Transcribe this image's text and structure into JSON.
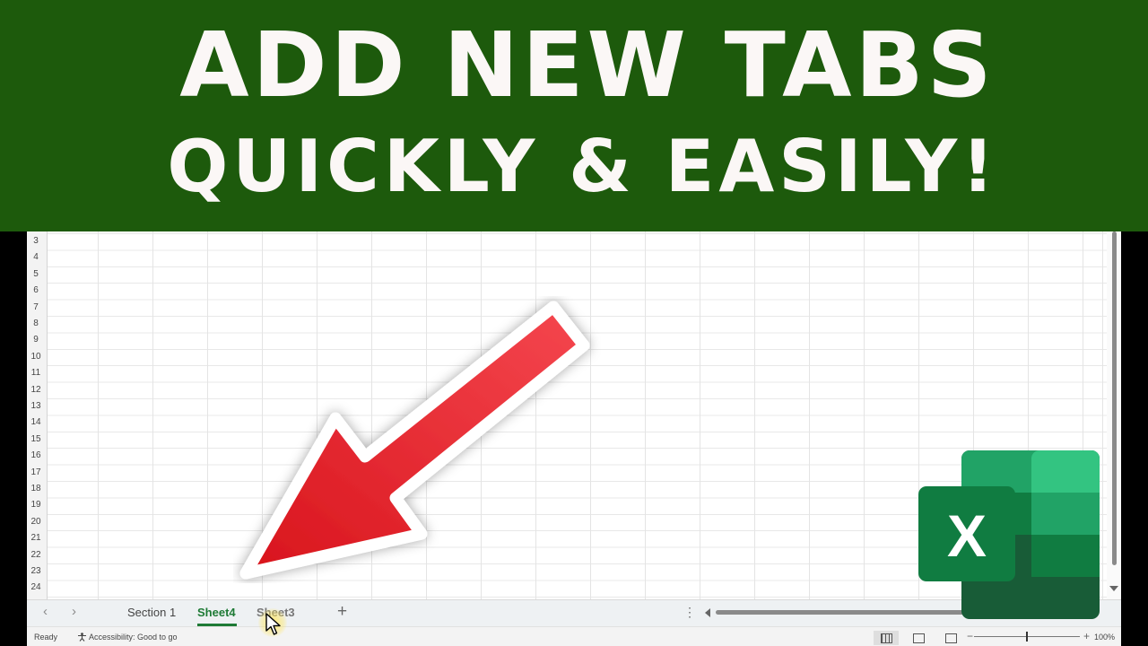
{
  "banner": {
    "line1": "ADD NEW TABS",
    "line2": "QUICKLY & EASILY!"
  },
  "colors": {
    "banner_bg": "#1d5a0c",
    "arrow_red": "#e8232d",
    "excel_green": "#1e7a35"
  },
  "spreadsheet": {
    "row_numbers": [
      "3",
      "4",
      "5",
      "6",
      "7",
      "8",
      "9",
      "10",
      "11",
      "12",
      "13",
      "14",
      "15",
      "16",
      "17",
      "18",
      "19",
      "20",
      "21",
      "22",
      "23",
      "24"
    ]
  },
  "tabbar": {
    "prev_icon": "‹",
    "next_icon": "›",
    "tabs": [
      {
        "label": "Section 1",
        "active": false
      },
      {
        "label": "Sheet4",
        "active": true
      },
      {
        "label": "Sheet3",
        "active": false
      }
    ],
    "add_sheet": "+",
    "more_icon": "⋮"
  },
  "statusbar": {
    "ready": "Ready",
    "accessibility": "Accessibility: Good to go",
    "zoom_minus": "−",
    "zoom_plus": "+",
    "zoom": "100%"
  },
  "logo": {
    "letter": "X"
  }
}
